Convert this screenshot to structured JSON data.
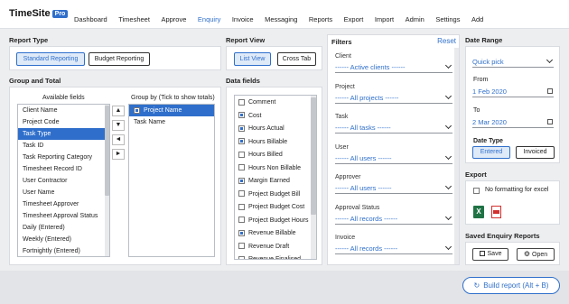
{
  "app": {
    "title": "TimeSite",
    "badge": "Pro"
  },
  "nav": [
    "Dashboard",
    "Timesheet",
    "Approve",
    "Enquiry",
    "Invoice",
    "Messaging",
    "Reports",
    "Export",
    "Import",
    "Admin",
    "Settings",
    "Add"
  ],
  "report_type": {
    "title": "Report Type",
    "standard": "Standard Reporting",
    "budget": "Budget Reporting"
  },
  "report_view": {
    "title": "Report View",
    "list": "List View",
    "cross": "Cross Tab"
  },
  "group_total": {
    "title": "Group and Total",
    "available_header": "Available fields",
    "group_header": "Group by (Tick to show totals)",
    "available": [
      "Client Name",
      "Project Code",
      "Task Type",
      "Task ID",
      "Task Reporting Category",
      "Timesheet Record ID",
      "User Contractor",
      "User Name",
      "Timesheet Approver",
      "Timesheet Approval Status",
      "Daily (Entered)",
      "Weekly (Entered)",
      "Fortnightly (Entered)"
    ],
    "selected_available": "Task Type",
    "group_by": [
      "Project Name",
      "Task Name"
    ],
    "selected_group": "Project Name",
    "arrows": [
      "▲",
      "▼",
      "◄",
      "►"
    ]
  },
  "data_fields": {
    "title": "Data fields",
    "items": [
      {
        "label": "Comment",
        "checked": false
      },
      {
        "label": "Cost",
        "checked": true
      },
      {
        "label": "Hours Actual",
        "checked": true
      },
      {
        "label": "Hours Billable",
        "checked": true
      },
      {
        "label": "Hours Billed",
        "checked": false
      },
      {
        "label": "Hours Non Billable",
        "checked": false
      },
      {
        "label": "Margin Earned",
        "checked": true
      },
      {
        "label": "Project Budget Bill",
        "checked": false
      },
      {
        "label": "Project Budget Cost",
        "checked": false
      },
      {
        "label": "Project Budget Hours",
        "checked": false
      },
      {
        "label": "Revenue Billable",
        "checked": true
      },
      {
        "label": "Revenue Draft",
        "checked": false
      },
      {
        "label": "Revenue Finalised",
        "checked": false
      }
    ]
  },
  "filters": {
    "title": "Filters",
    "reset": "Reset",
    "items": [
      {
        "label": "Client",
        "value": "------ Active clients ------"
      },
      {
        "label": "Project",
        "value": "------ All projects ------"
      },
      {
        "label": "Task",
        "value": "------ All tasks ------"
      },
      {
        "label": "User",
        "value": "------ All users ------"
      },
      {
        "label": "Approver",
        "value": "------ All users ------"
      },
      {
        "label": "Approval Status",
        "value": "------ All records ------"
      },
      {
        "label": "Invoice",
        "value": "------ All records ------"
      }
    ]
  },
  "date_range": {
    "title": "Date Range",
    "quick": "Quick pick",
    "from_label": "From",
    "from": "1 Feb 2020",
    "to_label": "To",
    "to": "2 Mar 2020",
    "type_label": "Date Type",
    "entered": "Entered",
    "invoiced": "Invoiced"
  },
  "export": {
    "title": "Export",
    "no_format": "No formatting for excel"
  },
  "saved": {
    "title": "Saved Enquiry Reports",
    "save": "Save",
    "open": "Open"
  },
  "build": "Build report (Alt + B)",
  "colors": {
    "accent": "#2f6fcb",
    "excel": "#1f7244",
    "pdf": "#d32f2f"
  }
}
